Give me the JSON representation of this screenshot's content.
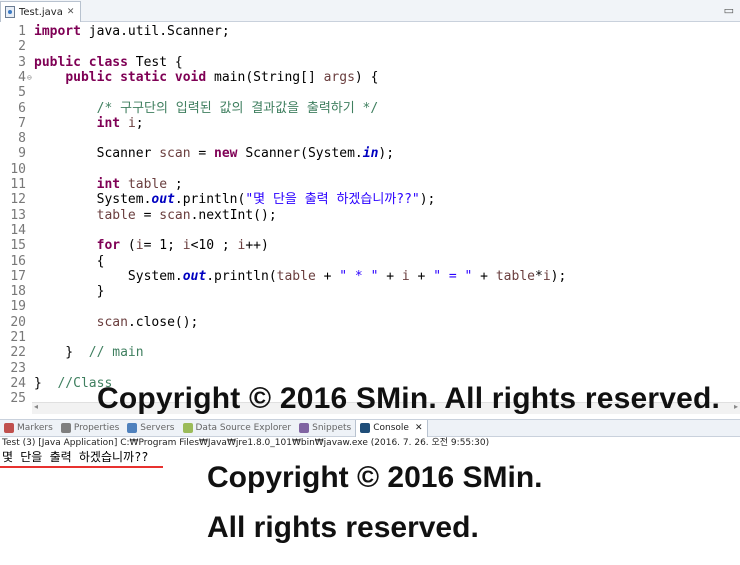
{
  "editor_tab": {
    "title": "Test.java",
    "close": "✕",
    "minimize": "▭"
  },
  "lines": [
    {
      "n": "1",
      "segs": [
        [
          "kw",
          "import"
        ],
        [
          "p",
          " java.util.Scanner;"
        ]
      ]
    },
    {
      "n": "2",
      "segs": []
    },
    {
      "n": "3",
      "segs": [
        [
          "kw",
          "public class"
        ],
        [
          "p",
          " Test {"
        ]
      ]
    },
    {
      "n": "4",
      "fold": "⊖",
      "segs": [
        [
          "p",
          "    "
        ],
        [
          "kw",
          "public static void"
        ],
        [
          "p",
          " main(String[] "
        ],
        [
          "var",
          "args"
        ],
        [
          "p",
          ") {"
        ]
      ]
    },
    {
      "n": "5",
      "segs": []
    },
    {
      "n": "6",
      "segs": [
        [
          "p",
          "        "
        ],
        [
          "cmt",
          "/* 구구단의 입력된 값의 결과값을 출력하기 */"
        ]
      ]
    },
    {
      "n": "7",
      "segs": [
        [
          "p",
          "        "
        ],
        [
          "kw",
          "int"
        ],
        [
          "p",
          " "
        ],
        [
          "var",
          "i"
        ],
        [
          "p",
          ";"
        ]
      ]
    },
    {
      "n": "8",
      "segs": []
    },
    {
      "n": "9",
      "segs": [
        [
          "p",
          "        Scanner "
        ],
        [
          "var",
          "scan"
        ],
        [
          "p",
          " = "
        ],
        [
          "kw",
          "new"
        ],
        [
          "p",
          " Scanner(System."
        ],
        [
          "field",
          "in"
        ],
        [
          "p",
          ");"
        ]
      ]
    },
    {
      "n": "10",
      "segs": []
    },
    {
      "n": "11",
      "segs": [
        [
          "p",
          "        "
        ],
        [
          "kw",
          "int"
        ],
        [
          "p",
          " "
        ],
        [
          "var",
          "table"
        ],
        [
          "p",
          " ;"
        ]
      ]
    },
    {
      "n": "12",
      "segs": [
        [
          "p",
          "        System."
        ],
        [
          "field",
          "out"
        ],
        [
          "p",
          ".println("
        ],
        [
          "str",
          "\"몇 단을 출력 하겠습니까??\""
        ],
        [
          "p",
          ");"
        ]
      ]
    },
    {
      "n": "13",
      "segs": [
        [
          "p",
          "        "
        ],
        [
          "var",
          "table"
        ],
        [
          "p",
          " = "
        ],
        [
          "var",
          "scan"
        ],
        [
          "p",
          ".nextInt();"
        ]
      ]
    },
    {
      "n": "14",
      "segs": []
    },
    {
      "n": "15",
      "segs": [
        [
          "p",
          "        "
        ],
        [
          "kw",
          "for"
        ],
        [
          "p",
          " ("
        ],
        [
          "var",
          "i"
        ],
        [
          "p",
          "= 1; "
        ],
        [
          "var",
          "i"
        ],
        [
          "p",
          "<10 ; "
        ],
        [
          "var",
          "i"
        ],
        [
          "p",
          "++)"
        ]
      ]
    },
    {
      "n": "16",
      "segs": [
        [
          "p",
          "        {"
        ]
      ]
    },
    {
      "n": "17",
      "segs": [
        [
          "p",
          "            System."
        ],
        [
          "field",
          "out"
        ],
        [
          "p",
          ".println("
        ],
        [
          "var",
          "table"
        ],
        [
          "p",
          " + "
        ],
        [
          "str",
          "\" * \""
        ],
        [
          "p",
          " + "
        ],
        [
          "var",
          "i"
        ],
        [
          "p",
          " + "
        ],
        [
          "str",
          "\" = \""
        ],
        [
          "p",
          " + "
        ],
        [
          "var",
          "table"
        ],
        [
          "p",
          "*"
        ],
        [
          "var",
          "i"
        ],
        [
          "p",
          ");"
        ]
      ]
    },
    {
      "n": "18",
      "segs": [
        [
          "p",
          "        }"
        ]
      ]
    },
    {
      "n": "19",
      "segs": []
    },
    {
      "n": "20",
      "segs": [
        [
          "p",
          "        "
        ],
        [
          "var",
          "scan"
        ],
        [
          "p",
          ".close();"
        ]
      ]
    },
    {
      "n": "21",
      "segs": []
    },
    {
      "n": "22",
      "segs": [
        [
          "p",
          "    }  "
        ],
        [
          "cmt",
          "// main"
        ]
      ]
    },
    {
      "n": "23",
      "segs": []
    },
    {
      "n": "24",
      "segs": [
        [
          "p",
          "}  "
        ],
        [
          "cmt",
          "//Class"
        ]
      ]
    },
    {
      "n": "25",
      "segs": []
    }
  ],
  "console_tabs": [
    {
      "label": "Markers",
      "color": "#c0504d",
      "active": false
    },
    {
      "label": "Properties",
      "color": "#7f7f7f",
      "active": false
    },
    {
      "label": "Servers",
      "color": "#4f81bd",
      "active": false
    },
    {
      "label": "Data Source Explorer",
      "color": "#9bbb59",
      "active": false
    },
    {
      "label": "Snippets",
      "color": "#8064a2",
      "active": false
    },
    {
      "label": "Console",
      "color": "#1f4e79",
      "active": true
    }
  ],
  "console_close": "✕",
  "console_description": "Test (3) [Java Application] C:₩Program Files₩Java₩jre1.8.0_101₩bin₩javaw.exe (2016. 7. 26. 오전 9:55:30)",
  "console_output": "몇 단을 출력 하겠습니까??",
  "watermarks": {
    "main": "Copyright © 2016 SMin. All rights reserved.",
    "line1": "Copyright © 2016 SMin.",
    "line2": "All rights reserved."
  }
}
